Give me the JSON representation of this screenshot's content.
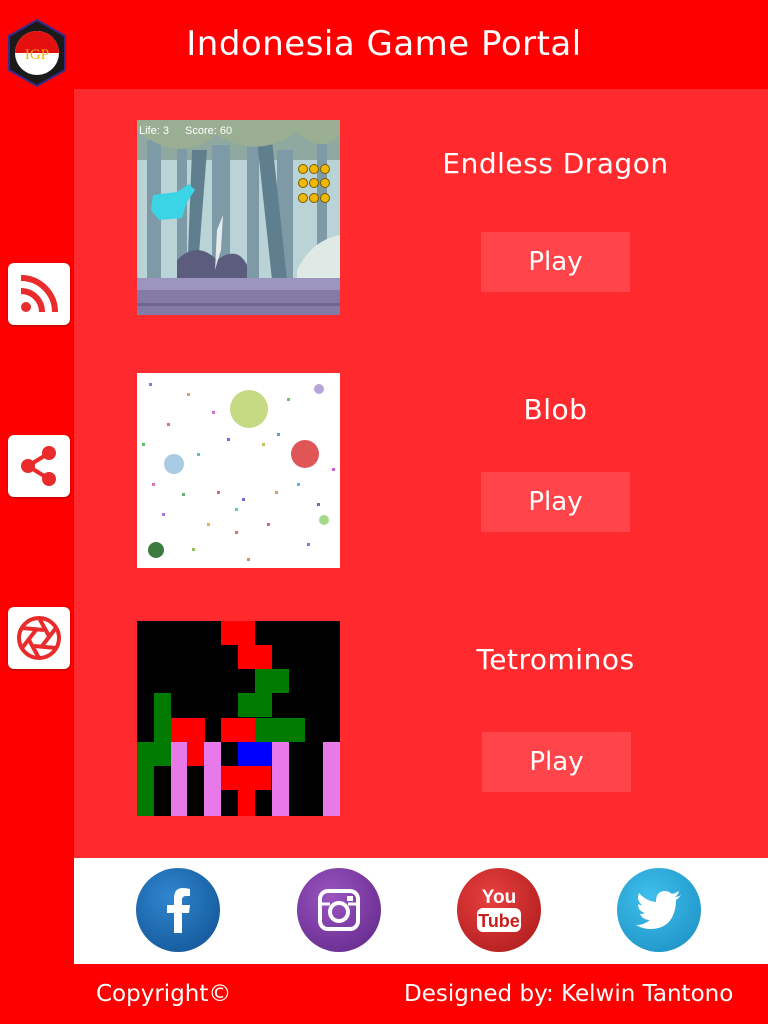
{
  "header": {
    "title": "Indonesia Game Portal",
    "logo_text": "IGP"
  },
  "sidebar": {
    "items": [
      {
        "icon": "rss-icon"
      },
      {
        "icon": "share-icon"
      },
      {
        "icon": "aperture-icon"
      }
    ]
  },
  "games": [
    {
      "title": "Endless Dragon",
      "play_label": "Play",
      "hud_life": "Life: 3",
      "hud_score": "Score: 60"
    },
    {
      "title": "Blob",
      "play_label": "Play"
    },
    {
      "title": "Tetrominos",
      "play_label": "Play"
    }
  ],
  "social": [
    {
      "name": "facebook",
      "color": "#1d68b0"
    },
    {
      "name": "instagram",
      "color": "#7e3aa3"
    },
    {
      "name": "youtube",
      "color": "#d42526"
    },
    {
      "name": "twitter",
      "color": "#28a8dc"
    }
  ],
  "footer": {
    "copyright": "Copyright©",
    "designer": "Designed by: Kelwin Tantono"
  },
  "colors": {
    "background": "#ff0000",
    "panel": "#ff2a2d",
    "button": "#ff4549"
  }
}
